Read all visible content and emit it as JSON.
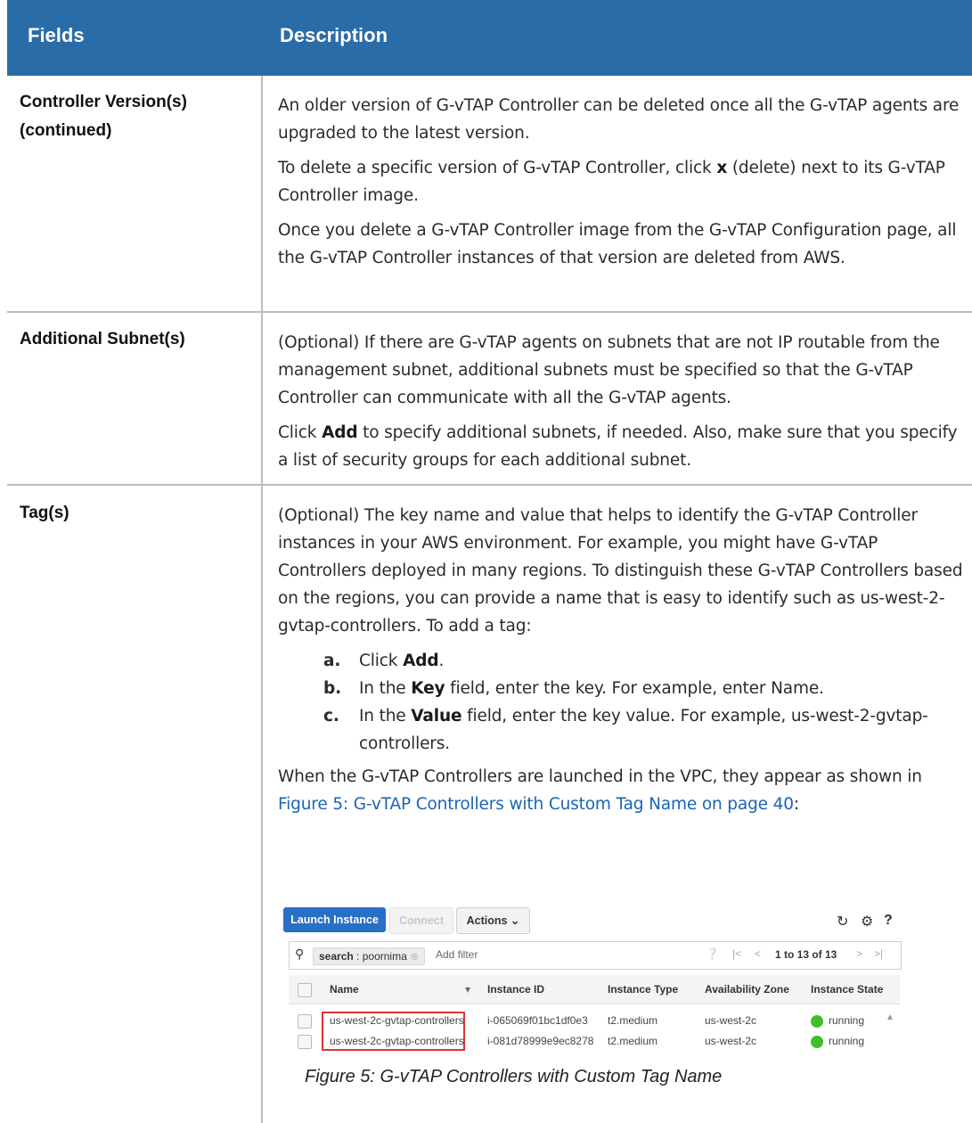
{
  "header": {
    "col1": "Fields",
    "col2": "Description"
  },
  "rows": [
    {
      "field_line1": "Controller Version(s)",
      "field_line2": "(continued)",
      "p1": "An older version of G-vTAP Controller can be deleted once all the G-vTAP agents are upgraded to the latest version.",
      "p2_pre": "To delete a specific version of G-vTAP Controller, click ",
      "p2_bold": "x",
      "p2_post": " (delete) next to its G-vTAP Controller image.",
      "p3": "Once you delete a G-vTAP Controller image from the G-vTAP Configuration page, all the G-vTAP Controller instances of that version are deleted from AWS."
    },
    {
      "field": "Additional Subnet(s)",
      "p1": "(Optional) If there are G-vTAP agents on subnets that are not IP routable from the management subnet, additional subnets must be specified so that the G-vTAP Controller can communicate with all the G-vTAP agents.",
      "p2_pre": "Click ",
      "p2_bold": "Add",
      "p2_post": " to specify additional subnets, if needed. Also, make sure that you specify a list of security groups for each additional subnet."
    },
    {
      "field": "Tag(s)",
      "p1": "(Optional) The key name and value that helps to identify the G-vTAP Controller instances in your AWS environment. For example, you might have G-vTAP Controllers deployed in many regions. To distinguish these G-vTAP Controllers based on the regions, you can provide a name that is easy to identify such as us-west-2-gvtap-controllers. To add a tag:",
      "steps": [
        {
          "letter": "a.",
          "pre": "Click ",
          "bold": "Add",
          "post": "."
        },
        {
          "letter": "b.",
          "pre": "In the ",
          "bold": "Key",
          "post": " field, enter the key. For example, enter Name."
        },
        {
          "letter": "c.",
          "pre": "In the ",
          "bold": "Value",
          "post": " field, enter the key value. For example, us-west-2-gvtap-controllers."
        }
      ],
      "p2_pre": "When the G-vTAP Controllers are launched in the VPC, they appear as shown in ",
      "p2_link": "Figure 5: G-vTAP Controllers with Custom Tag Name on page 40",
      "p2_post": ":"
    }
  ],
  "screenshot": {
    "launch_label": "Launch Instance",
    "connect_label": "Connect",
    "actions_label": "Actions",
    "search_key": "search",
    "search_value": "poornima",
    "add_filter_placeholder": "Add filter",
    "pagination": "1 to 13 of 13",
    "columns": [
      "Name",
      "Instance ID",
      "Instance Type",
      "Availability Zone",
      "Instance State"
    ],
    "instances": [
      {
        "name": "us-west-2c-gvtap-controllers",
        "id": "i-065069f01bc1df0e3",
        "type": "t2.medium",
        "zone": "us-west-2c",
        "state": "running"
      },
      {
        "name": "us-west-2c-gvtap-controllers",
        "id": "i-081d78999e9ec8278",
        "type": "t2.medium",
        "zone": "us-west-2c",
        "state": "running"
      }
    ],
    "state_color": "#3fbf2a",
    "highlight_color": "#dd3333"
  },
  "caption": "Figure 5: G-vTAP Controllers with Custom Tag Name",
  "colors": {
    "header_bg": "#2a6ca8",
    "link": "#1a64b4"
  }
}
